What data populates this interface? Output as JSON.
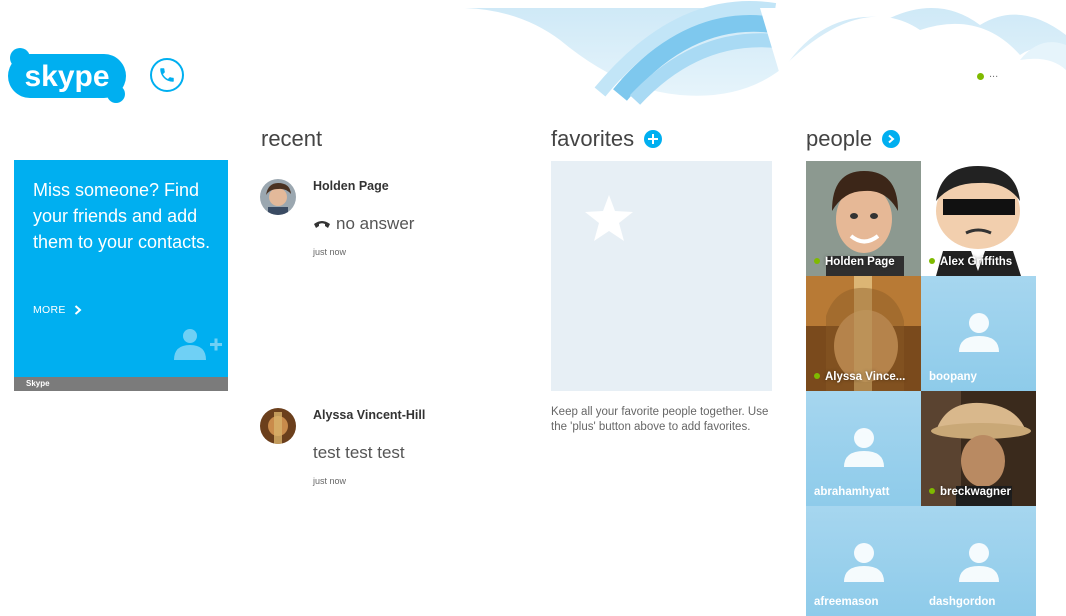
{
  "header": {
    "logo_text": "skype",
    "status_ellipsis": "...",
    "colors": {
      "accent": "#00aff0",
      "online": "#7fba00"
    }
  },
  "promo": {
    "text": "Miss someone? Find your friends and add them to your contacts.",
    "more_label": "MORE",
    "footer_label": "Skype"
  },
  "recent": {
    "title": "recent",
    "items": [
      {
        "name": "Holden Page",
        "message": "no answer",
        "message_icon": "missed-call-icon",
        "time": "just now"
      },
      {
        "name": "Alyssa Vincent-Hill",
        "message": "test test test",
        "time": "just now"
      }
    ]
  },
  "favorites": {
    "title": "favorites",
    "help": "Keep all your favorite people together. Use the 'plus' button above to add favorites."
  },
  "people": {
    "title": "people",
    "contacts": [
      {
        "name": "Holden Page",
        "online": true,
        "photo": true
      },
      {
        "name": "Alex Griffiths",
        "online": true,
        "photo": true
      },
      {
        "name": "Alyssa Vince...",
        "online": true,
        "photo": true
      },
      {
        "name": "boopany",
        "online": false,
        "photo": false
      },
      {
        "name": "abrahamhyatt",
        "online": false,
        "photo": false
      },
      {
        "name": "breckwagner",
        "online": true,
        "photo": true
      },
      {
        "name": "afreemason",
        "online": false,
        "photo": false
      },
      {
        "name": "dashgordon",
        "online": false,
        "photo": false
      }
    ]
  }
}
